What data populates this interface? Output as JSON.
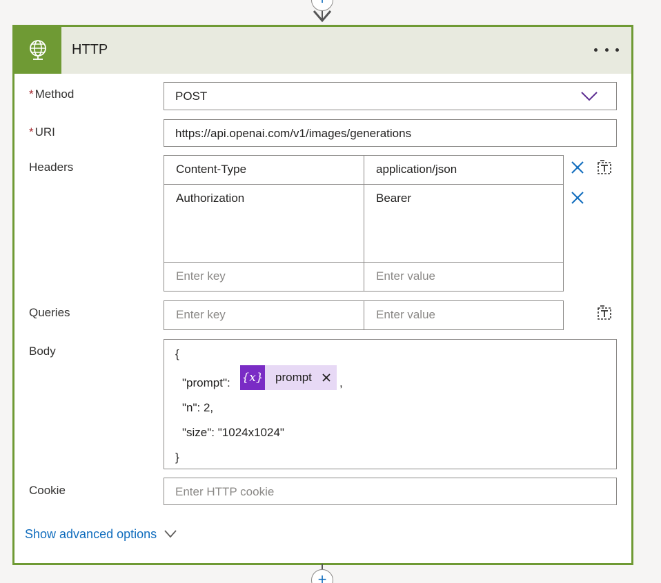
{
  "card": {
    "title": "HTTP",
    "icon": "globe-icon",
    "accent_color": "#6f9a34",
    "header_bg": "#e8eadf"
  },
  "method": {
    "label": "Method",
    "required_mark": "*",
    "value": "POST"
  },
  "uri": {
    "label": "URI",
    "required_mark": "*",
    "value": "https://api.openai.com/v1/images/generations"
  },
  "headers": {
    "label": "Headers",
    "rows": [
      {
        "key": "Content-Type",
        "value": "application/json"
      },
      {
        "key": "Authorization",
        "value": "Bearer"
      }
    ],
    "key_placeholder": "Enter key",
    "value_placeholder": "Enter value"
  },
  "queries": {
    "label": "Queries",
    "key_placeholder": "Enter key",
    "value_placeholder": "Enter value"
  },
  "body": {
    "label": "Body",
    "open_brace": "{",
    "prompt_key": "\"prompt\":",
    "token_symbol": "{x}",
    "token_label": "prompt",
    "token_color": "#7a2cc5",
    "after_token": ",",
    "n_line": "\"n\": 2,",
    "size_line": "\"size\": \"1024x1024\"",
    "close_brace": "}"
  },
  "cookie": {
    "label": "Cookie",
    "placeholder": "Enter HTTP cookie"
  },
  "advanced": {
    "label": "Show advanced options"
  }
}
